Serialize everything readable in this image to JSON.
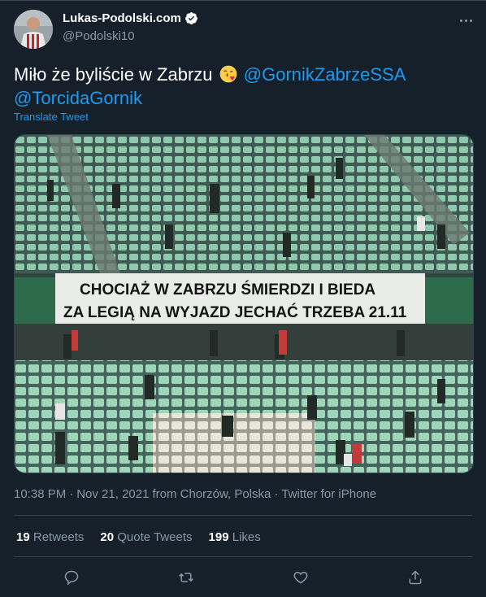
{
  "author": {
    "display_name": "Lukas-Podolski.com",
    "handle": "@Podolski10"
  },
  "tweet": {
    "text_prefix": "Miło że byliście w Zabrzu",
    "emoji": "face-blowing-kiss",
    "mention_1": "@GornikZabrzeSSA",
    "mention_2": "@TorcidaGornik",
    "translate_label": "Translate Tweet"
  },
  "media": {
    "banner_line_1": "CHOCIAŻ W ZABRZU ŚMIERDZI I BIEDA",
    "banner_line_2": "ZA LEGIĄ NA WYJAZD JECHAĆ TRZEBA 21.11"
  },
  "meta": {
    "time": "10:38 PM",
    "date": "Nov 21, 2021",
    "from": "from Chorzów, Polska",
    "source": "Twitter for iPhone",
    "sep": "·"
  },
  "stats": {
    "retweets_count": "19",
    "retweets_label": "Retweets",
    "quotes_count": "20",
    "quotes_label": "Quote Tweets",
    "likes_count": "199",
    "likes_label": "Likes"
  },
  "icons": [
    "verified-badge-icon",
    "more-icon",
    "reply-icon",
    "retweet-icon",
    "like-icon",
    "share-icon"
  ],
  "colors": {
    "background": "#15202b",
    "accent": "#1d9bf0",
    "muted": "#8899a6",
    "border": "#38444d"
  }
}
